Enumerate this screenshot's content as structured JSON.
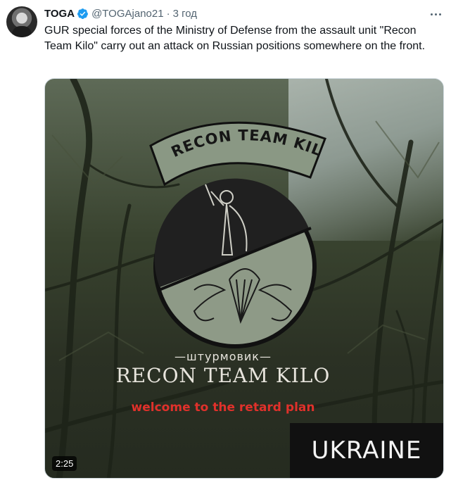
{
  "tweet": {
    "author_name": "TOGA",
    "handle": "@TOGAjano21",
    "separator": "·",
    "time": "3 год",
    "text": "GUR special forces of the Ministry of Defense from the assault unit \"Recon Team Kilo\" carry out an attack on Russian positions somewhere on the front."
  },
  "media": {
    "patch_arc_text": "RECON TEAM KILO",
    "subtitle": "—штурмовик—",
    "brand": "RECON TEAM KILO",
    "caption": "welcome to the retard plan",
    "watermark": "UKRAINE",
    "duration": "2:25",
    "caption_color": "#e0312b"
  },
  "icons": {
    "verified": "verified-badge-icon",
    "more": "more-options-icon"
  },
  "colors": {
    "verified_blue": "#1d9bf0",
    "secondary_text": "#536471"
  }
}
